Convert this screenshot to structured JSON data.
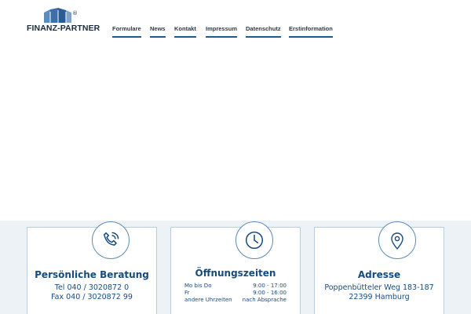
{
  "header": {
    "logo_text": "FINANZ-PARTNER",
    "logo_mark": "®",
    "nav": [
      {
        "label": "Formulare"
      },
      {
        "label": "News"
      },
      {
        "label": "Kontakt"
      },
      {
        "label": "Impressum"
      },
      {
        "label": "Datenschutz"
      },
      {
        "label": "Erstinformation"
      }
    ]
  },
  "footer": {
    "consult": {
      "icon": "phone-icon",
      "title": "Persönliche Beratung",
      "tel": "Tel 040 / 3020872 0",
      "fax": "Fax 040 / 3020872 99"
    },
    "hours": {
      "icon": "clock-icon",
      "title": "Öffnungszeiten",
      "rows": [
        {
          "days": "Mo bis Do",
          "time": "9:00 - 17:00"
        },
        {
          "days": "Fr",
          "time": "9:00 - 16:00"
        },
        {
          "days": "andere Uhrzeiten",
          "time": "nach Absprache"
        }
      ]
    },
    "address": {
      "icon": "location-pin-icon",
      "title": "Adresse",
      "street": "Poppenbütteler Weg 183-187",
      "city": "22399 Hamburg"
    }
  },
  "colors": {
    "brand_blue": "#164b7e",
    "logo_blue": "#3f6fa6",
    "band": "#edf2f6",
    "card_border": "#b8cde0"
  }
}
